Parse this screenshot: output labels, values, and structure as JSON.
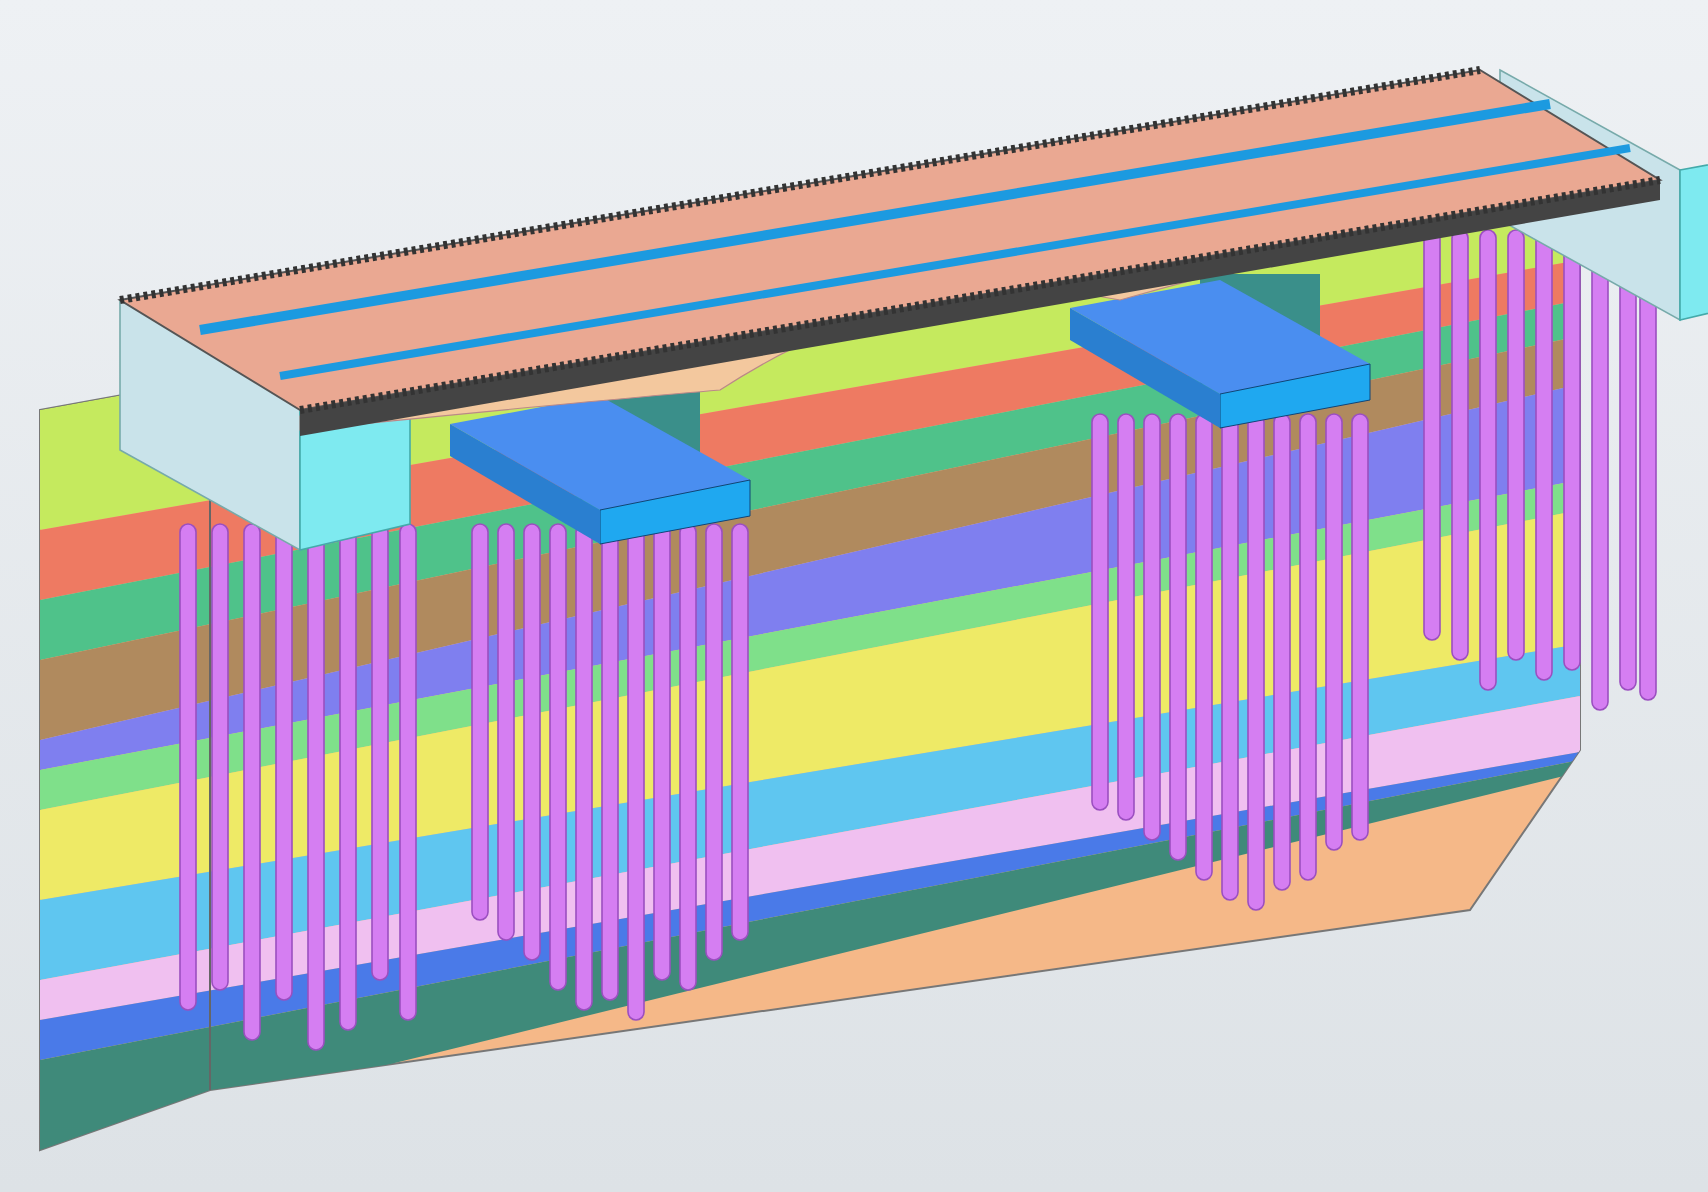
{
  "model": {
    "soil_layers": [
      {
        "color": "#c5ea5e"
      },
      {
        "color": "#ee7a62"
      },
      {
        "color": "#4fc28a"
      },
      {
        "color": "#b08a5e"
      },
      {
        "color": "#7f7fef"
      },
      {
        "color": "#7fe08a"
      },
      {
        "color": "#eeea66"
      },
      {
        "color": "#5fc6f0"
      },
      {
        "color": "#f0c0f0"
      },
      {
        "color": "#4a7ae8"
      },
      {
        "color": "#3f8a7a"
      }
    ],
    "supports": [
      {
        "kind": "abutment"
      },
      {
        "kind": "pier"
      },
      {
        "kind": "pier"
      },
      {
        "kind": "abutment"
      }
    ]
  }
}
